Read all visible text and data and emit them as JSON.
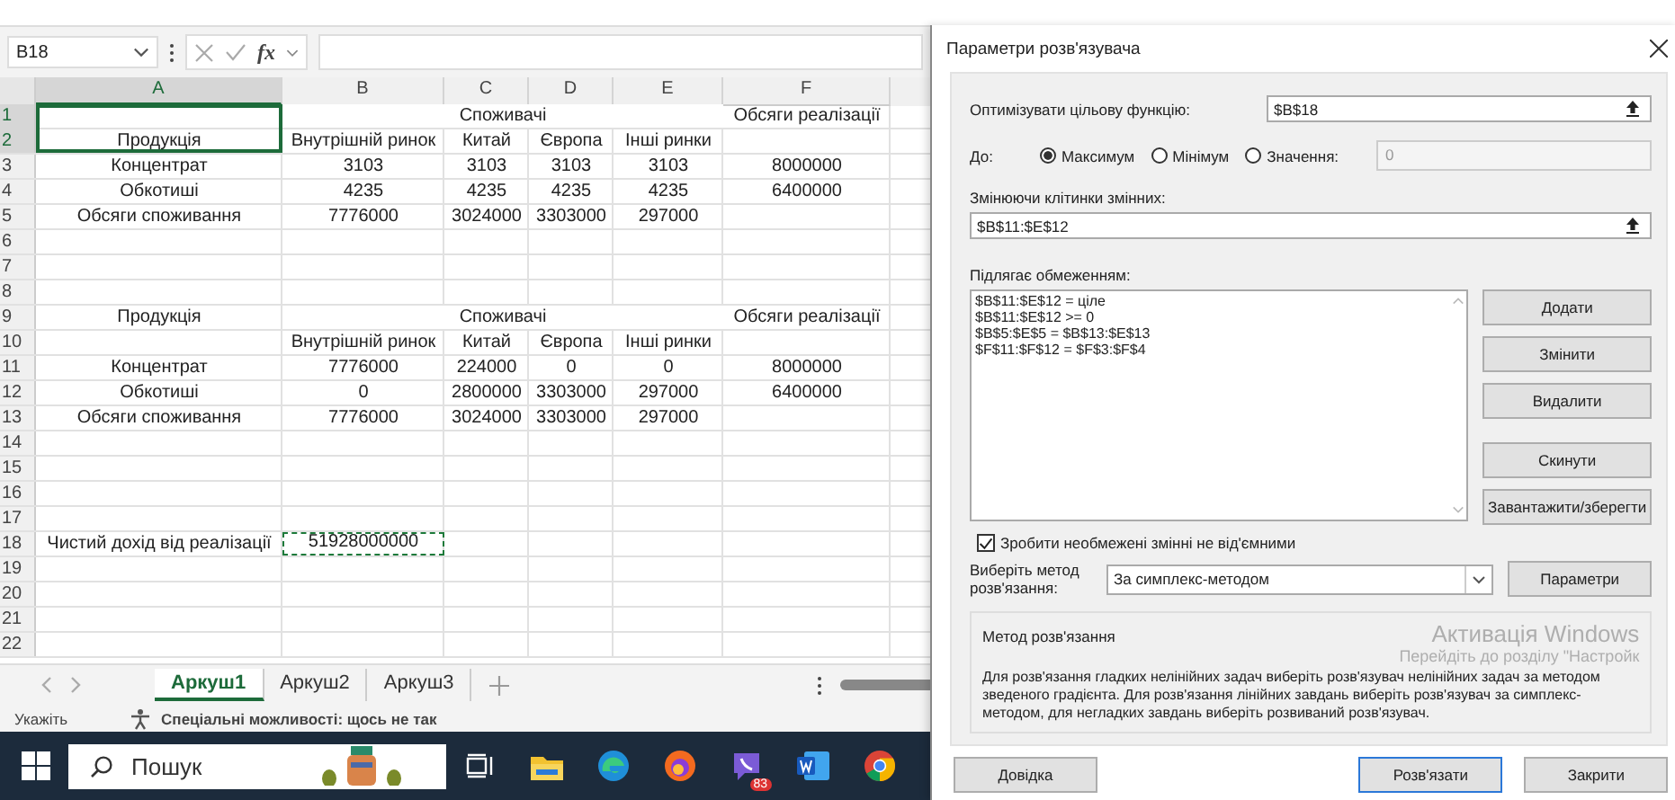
{
  "spreadsheet": {
    "name_box": "B18",
    "function_label": "fx",
    "columns": [
      {
        "label": "A",
        "selected": true
      },
      {
        "label": "B",
        "selected": false
      },
      {
        "label": "C",
        "selected": false
      },
      {
        "label": "D",
        "selected": false
      },
      {
        "label": "E",
        "selected": false
      },
      {
        "label": "F",
        "selected": false
      }
    ],
    "rows": [
      {
        "num": "1",
        "selected": true,
        "kind": "group",
        "cells": [
          null,
          "Споживачі",
          "Обсяги реалізації"
        ]
      },
      {
        "num": "2",
        "selected": true,
        "kind": "plain",
        "cells": [
          "Продукція",
          "Внутрішній ринок",
          "Китай",
          "Європа",
          "Інші ринки",
          null
        ]
      },
      {
        "num": "3",
        "selected": false,
        "kind": "plain",
        "cells": [
          "Концентрат",
          "3103",
          "3103",
          "3103",
          "3103",
          "8000000"
        ]
      },
      {
        "num": "4",
        "selected": false,
        "kind": "plain",
        "cells": [
          "Обкотиші",
          "4235",
          "4235",
          "4235",
          "4235",
          "6400000"
        ]
      },
      {
        "num": "5",
        "selected": false,
        "kind": "plain",
        "cells": [
          "Обсяги споживання",
          "7776000",
          "3024000",
          "3303000",
          "297000",
          null
        ]
      },
      {
        "num": "6",
        "selected": false,
        "kind": "plain",
        "cells": []
      },
      {
        "num": "7",
        "selected": false,
        "kind": "plain",
        "cells": []
      },
      {
        "num": "8",
        "selected": false,
        "kind": "plain",
        "cells": []
      },
      {
        "num": "9",
        "selected": false,
        "kind": "group",
        "cells": [
          "Продукція",
          "Споживачі",
          "Обсяги реалізації"
        ]
      },
      {
        "num": "10",
        "selected": false,
        "kind": "plain",
        "cells": [
          null,
          "Внутрішній ринок",
          "Китай",
          "Європа",
          "Інші ринки",
          null
        ]
      },
      {
        "num": "11",
        "selected": false,
        "kind": "plain",
        "cells": [
          "Концентрат",
          "7776000",
          "224000",
          "0",
          "0",
          "8000000"
        ]
      },
      {
        "num": "12",
        "selected": false,
        "kind": "plain",
        "cells": [
          "Обкотиші",
          "0",
          "2800000",
          "3303000",
          "297000",
          "6400000"
        ]
      },
      {
        "num": "13",
        "selected": false,
        "kind": "plain",
        "cells": [
          "Обсяги споживання",
          "7776000",
          "3024000",
          "3303000",
          "297000",
          null
        ]
      },
      {
        "num": "14",
        "selected": false,
        "kind": "plain",
        "cells": []
      },
      {
        "num": "15",
        "selected": false,
        "kind": "plain",
        "cells": []
      },
      {
        "num": "16",
        "selected": false,
        "kind": "plain",
        "cells": []
      },
      {
        "num": "17",
        "selected": false,
        "kind": "plain",
        "cells": []
      },
      {
        "num": "18",
        "selected": false,
        "kind": "plain",
        "cells": [
          "Чистий дохід від реалізації",
          {
            "text": "51928000000",
            "copied": true
          }
        ]
      },
      {
        "num": "19",
        "selected": false,
        "kind": "plain",
        "cells": []
      },
      {
        "num": "20",
        "selected": false,
        "kind": "plain",
        "cells": []
      },
      {
        "num": "21",
        "selected": false,
        "kind": "plain",
        "cells": []
      },
      {
        "num": "22",
        "selected": false,
        "kind": "plain",
        "cells": []
      }
    ],
    "sheets": [
      {
        "label": "Аркуш1",
        "selected": true
      },
      {
        "label": "Аркуш2",
        "selected": false
      },
      {
        "label": "Аркуш3",
        "selected": false
      }
    ],
    "status": "Укажіть",
    "accessibility": "Спеціальні можливості: щось не так"
  },
  "taskbar": {
    "search_placeholder": "Пошук",
    "apps": [
      {
        "kind": "task-view"
      },
      {
        "kind": "folder"
      },
      {
        "kind": "edge"
      },
      {
        "kind": "firefox"
      },
      {
        "kind": "viber",
        "badge": "83"
      },
      {
        "kind": "word"
      },
      {
        "kind": "chrome"
      }
    ]
  },
  "dialog": {
    "title": "Параметри розв'язувача",
    "objective_label": "Оптимізувати цільову функцію:",
    "objective": "$B$18",
    "to_label": "До:",
    "targets": [
      {
        "label": "Максимум",
        "selected": true
      },
      {
        "label": "Мінімум",
        "selected": false
      },
      {
        "label": "Значення:",
        "selected": false
      }
    ],
    "value": "0",
    "value_disabled": true,
    "variables_label": "Змінюючи клітинки змінних:",
    "variables": "$B$11:$E$12",
    "constraints_label": "Підлягає обмеженням:",
    "constraints": [
      "$B$11:$E$12 = ціле",
      "$B$11:$E$12 >= 0",
      "$B$5:$E$5 = $B$13:$E$13",
      "$F$11:$F$12 = $F$3:$F$4"
    ],
    "side_buttons": [
      "Додати",
      "Змінити",
      "Видалити",
      "Скинути",
      "Завантажити/зберегти"
    ],
    "nonneg": {
      "label": "Зробити необмежені змінні не від'ємними",
      "checked": true
    },
    "method_label": "Виберіть метод розв'язання:",
    "method": "За симплекс-методом",
    "options_button": "Параметри",
    "method_group": {
      "title": "Метод розв'язання",
      "text": "Для розв'язання гладких нелінійних задач виберіть розв'язувач нелінійних задач за методом зведеного градієнта. Для розв'язання лінійних завдань виберіть розв'язувач за симплекс-методом, для негладких завдань виберіть розвиваний розв'язувач."
    },
    "footer_buttons": [
      {
        "label": "Довідка",
        "default": false
      },
      {
        "label": "Розв'язати",
        "default": true
      },
      {
        "label": "Закрити",
        "default": false
      }
    ],
    "activation": {
      "title": "Активація Windows",
      "text": "Перейдіть до розділу \"Настройк"
    }
  }
}
